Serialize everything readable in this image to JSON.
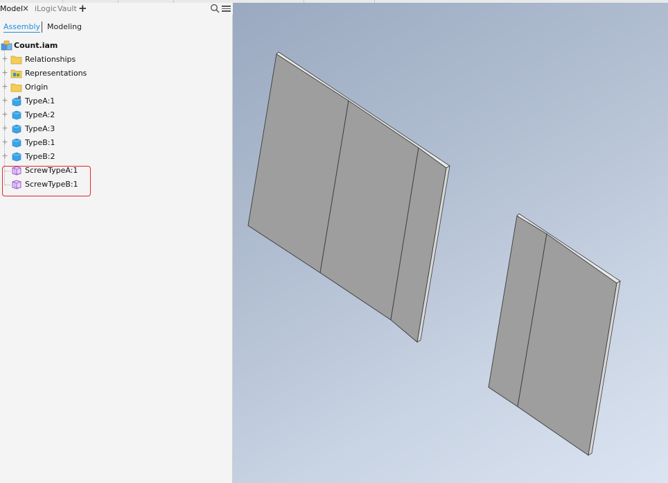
{
  "browser": {
    "tabs": [
      {
        "label": "Model",
        "active": true
      },
      {
        "label": "iLogic",
        "active": false
      },
      {
        "label": "Vault",
        "active": false
      }
    ],
    "close_glyph": "×",
    "add_glyph": "+",
    "subtabs": {
      "assembly": "Assembly",
      "modeling": "Modeling"
    },
    "tree": {
      "root": {
        "label": "Count.iam",
        "icon": "assembly-icon"
      },
      "items": [
        {
          "label": "Relationships",
          "icon": "folder-icon",
          "expandable": true
        },
        {
          "label": "Representations",
          "icon": "representations-icon",
          "expandable": true
        },
        {
          "label": "Origin",
          "icon": "folder-icon",
          "expandable": true
        },
        {
          "label": "TypeA:1",
          "icon": "part-grounded-icon",
          "expandable": true
        },
        {
          "label": "TypeA:2",
          "icon": "part-icon",
          "expandable": true
        },
        {
          "label": "TypeA:3",
          "icon": "part-icon",
          "expandable": true
        },
        {
          "label": "TypeB:1",
          "icon": "part-icon",
          "expandable": true
        },
        {
          "label": "TypeB:2",
          "icon": "part-icon",
          "expandable": true
        },
        {
          "label": "ScrewTypeA:1",
          "icon": "virtual-component-icon",
          "expandable": false
        },
        {
          "label": "ScrewTypeB:1",
          "icon": "virtual-component-icon",
          "expandable": false
        }
      ],
      "highlighted": [
        "ScrewTypeA:1",
        "ScrewTypeB:1"
      ]
    }
  },
  "colors": {
    "accent": "#1f8fd8",
    "highlight": "#e0262b",
    "panel_face": "#9e9e9e",
    "folder": "#f5cc55",
    "part": "#3aa4e8",
    "virtual": "#9b59d0"
  }
}
